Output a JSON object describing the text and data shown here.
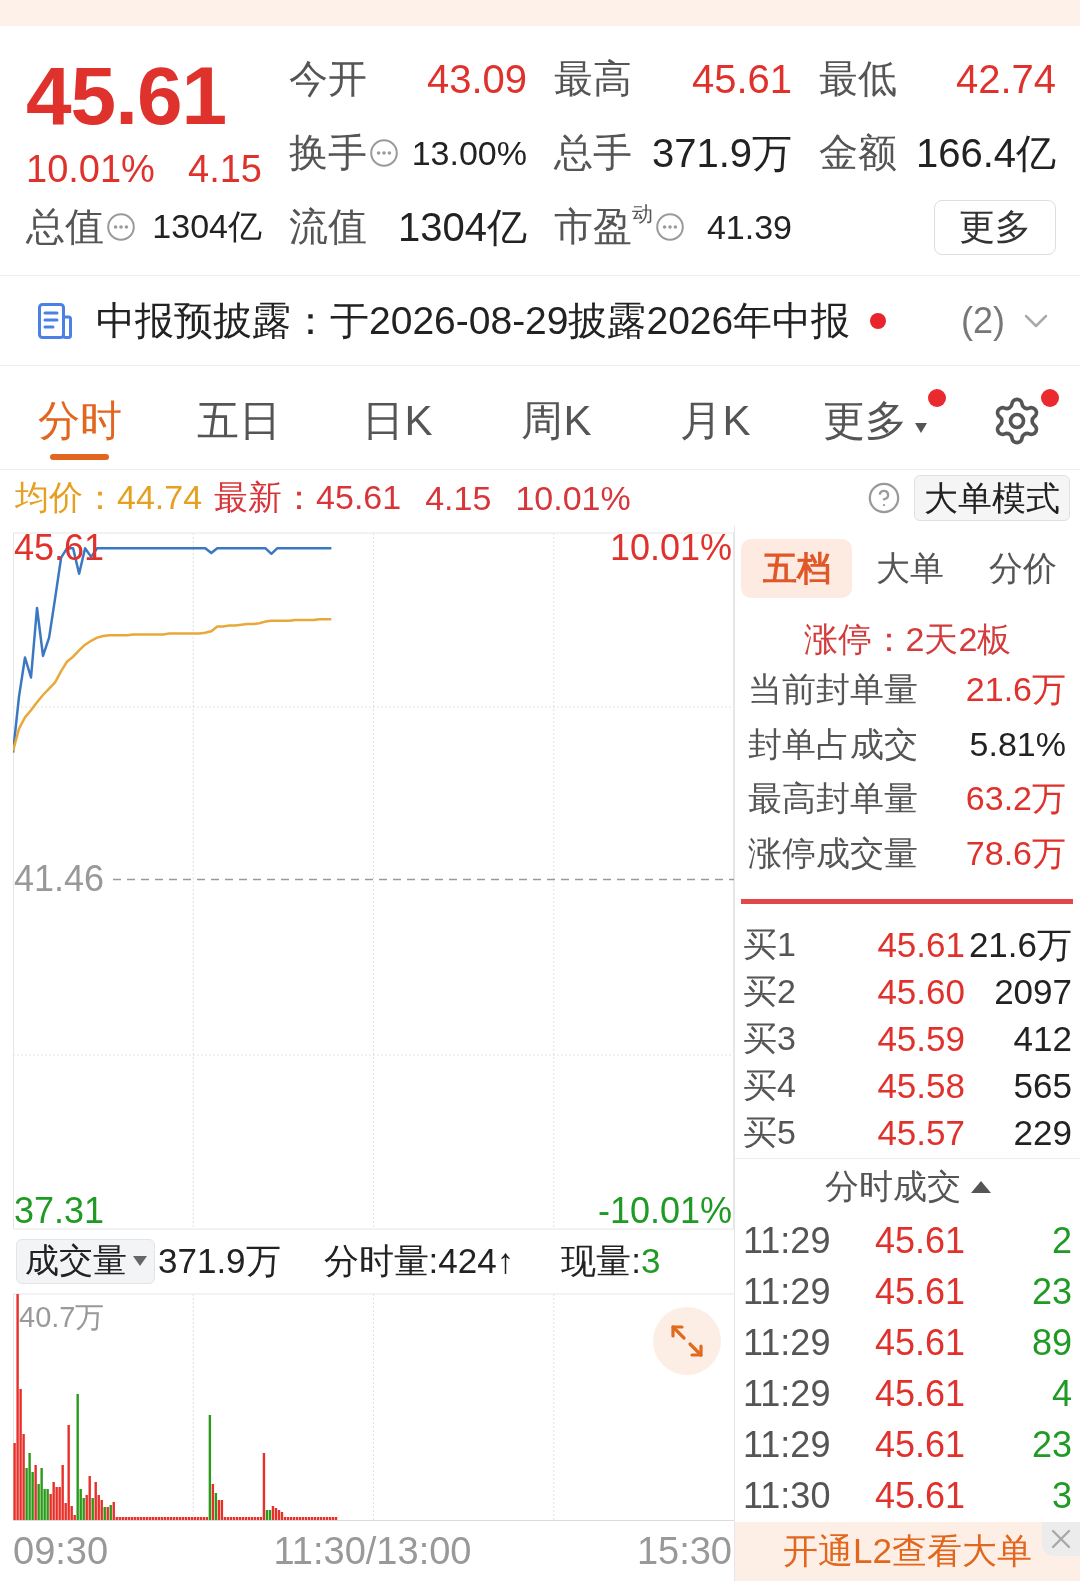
{
  "quote": {
    "price": "45.61",
    "change_pct": "10.01%",
    "change": "4.15",
    "stats": [
      {
        "label": "今开",
        "value": "43.09",
        "color": "#e0322d",
        "info": false
      },
      {
        "label": "最高",
        "value": "45.61",
        "color": "#e0322d",
        "info": false
      },
      {
        "label": "最低",
        "value": "42.74",
        "color": "#e0322d",
        "info": false
      },
      {
        "label": "换手",
        "value": "13.00%",
        "color": "#222222",
        "info": true
      },
      {
        "label": "总手",
        "value": "371.9万",
        "color": "#222222",
        "info": false
      },
      {
        "label": "金额",
        "value": "166.4亿",
        "color": "#222222",
        "info": false
      },
      {
        "label": "总值",
        "value": "1304亿",
        "color": "#222222",
        "info": true
      },
      {
        "label": "流值",
        "value": "1304亿",
        "color": "#222222",
        "info": false
      },
      {
        "label": "市盈$^{动}$",
        "value": "41.39",
        "color": "#222222",
        "info": true
      }
    ],
    "more_button": "更多"
  },
  "notice": {
    "text": "中报预披露：于2026-08-29披露2026年中报",
    "unread": true,
    "count": "(2)"
  },
  "chart_tabs": [
    {
      "label": "分时",
      "selected": true,
      "dropdown": false,
      "badge": false
    },
    {
      "label": "五日",
      "selected": false,
      "dropdown": false,
      "badge": false
    },
    {
      "label": "日K",
      "selected": false,
      "dropdown": false,
      "badge": false
    },
    {
      "label": "周K",
      "selected": false,
      "dropdown": false,
      "badge": false
    },
    {
      "label": "月K",
      "selected": false,
      "dropdown": false,
      "badge": false
    },
    {
      "label": "更多",
      "selected": false,
      "dropdown": true,
      "badge": true
    }
  ],
  "settings": {
    "badge": true
  },
  "info_bar": {
    "average": "均价：44.74",
    "latest": "最新：45.61",
    "change": "4.15",
    "change_pct": "10.01%",
    "mode_button": "大单模式"
  },
  "price_chart": {
    "pct_labels": [
      {
        "text": "10.01%",
        "color": "#e0322d"
      },
      {
        "text": "-10.01%",
        "color": "#1f9a24"
      }
    ],
    "chart_data": {
      "type": "line",
      "categories": [
        null,
        null,
        null,
        null,
        null,
        null,
        null,
        null,
        null,
        null,
        null,
        null,
        null,
        null,
        null,
        null,
        null,
        null,
        null,
        null,
        null,
        null,
        null,
        null,
        null,
        null,
        null,
        null,
        null,
        null,
        null,
        null,
        null,
        null,
        null,
        null,
        null,
        null,
        null,
        null,
        null,
        null,
        null,
        null,
        null,
        null,
        null,
        null,
        null,
        null,
        null,
        null,
        null,
        null,
        null,
        null,
        null,
        null,
        null,
        null,
        null,
        null,
        null,
        null,
        null,
        null,
        null,
        null,
        null,
        null,
        null,
        null,
        null,
        null,
        null,
        null,
        null,
        null,
        null,
        null,
        null,
        null,
        null,
        null,
        null,
        null,
        null,
        null,
        null,
        null,
        null,
        null,
        null,
        null,
        null,
        null,
        null,
        null,
        null,
        null,
        null,
        null,
        null,
        null,
        null,
        null,
        null,
        null,
        null,
        null,
        null,
        null,
        null,
        null,
        null,
        null,
        null,
        null,
        null,
        null,
        null
      ],
      "series": [
        {
          "color": "#3a78c2",
          "values": [
            43.05,
            43.75,
            44.24,
            43.99,
            44.86,
            44.26,
            44.49,
            44.98,
            45.49,
            45.61,
            45.61,
            45.29,
            45.61,
            45.5,
            45.61,
            45.61,
            45.61,
            45.61,
            45.61,
            45.61,
            45.61,
            45.61,
            45.61,
            45.61,
            45.61,
            45.61,
            45.61,
            45.61,
            45.61,
            45.61,
            45.61,
            45.61,
            45.61,
            45.55,
            45.61,
            45.61,
            45.61,
            45.61,
            45.61,
            45.61,
            45.61,
            45.61,
            45.61,
            45.54,
            45.61,
            45.61,
            45.61,
            45.61,
            45.61,
            45.61,
            45.61,
            45.61,
            45.61,
            45.61,
            null,
            null,
            null,
            null,
            null,
            null,
            null,
            null,
            null,
            null,
            null,
            null,
            null,
            null,
            null,
            null,
            null,
            null,
            null,
            null,
            null,
            null,
            null,
            null,
            null,
            null,
            null,
            null,
            null,
            null,
            null,
            null,
            null,
            null,
            null,
            null,
            null,
            null,
            null,
            null,
            null,
            null,
            null,
            null,
            null,
            null,
            null,
            null,
            null,
            null,
            null,
            null,
            null,
            null,
            null,
            null,
            null,
            null,
            null,
            null,
            null,
            null,
            null,
            null,
            null,
            null,
            null
          ]
        },
        {
          "color": "#e8a83a",
          "values": [
            43.07,
            43.35,
            43.49,
            43.58,
            43.68,
            43.77,
            43.85,
            43.93,
            44.07,
            44.19,
            44.25,
            44.33,
            44.4,
            44.45,
            44.49,
            44.51,
            44.52,
            44.52,
            44.52,
            44.52,
            44.53,
            44.53,
            44.53,
            44.53,
            44.53,
            44.53,
            44.54,
            44.54,
            44.54,
            44.54,
            44.54,
            44.54,
            44.55,
            44.57,
            44.63,
            44.63,
            44.64,
            44.64,
            44.65,
            44.66,
            44.66,
            44.67,
            44.69,
            44.7,
            44.7,
            44.7,
            44.7,
            44.71,
            44.71,
            44.71,
            44.71,
            44.72,
            44.72,
            44.72,
            null,
            null,
            null,
            null,
            null,
            null,
            null,
            null,
            null,
            null,
            null,
            null,
            null,
            null,
            null,
            null,
            null,
            null,
            null,
            null,
            null,
            null,
            null,
            null,
            null,
            null,
            null,
            null,
            null,
            null,
            null,
            null,
            null,
            null,
            null,
            null,
            null,
            null,
            null,
            null,
            null,
            null,
            null,
            null,
            null,
            null,
            null,
            null,
            null,
            null,
            null,
            null,
            null,
            null,
            null,
            null,
            null,
            null,
            null,
            null,
            null,
            null,
            null,
            null,
            null,
            null,
            null
          ]
        }
      ],
      "ylim": [
        37.08,
        45.8
      ],
      "yticks": [
        {
          "value": 45.61,
          "label": "45.61"
        },
        {
          "value": 41.46,
          "label": "41.46"
        },
        {
          "value": 37.31,
          "label": "37.31"
        }
      ],
      "ref_lines": [
        {
          "axis": "y",
          "value": 41.46
        }
      ]
    }
  },
  "volume": {
    "selector": "成交量",
    "total": "371.9万",
    "minute_volume": "分时量:424↑",
    "current_label": "现量:",
    "current_value": "3",
    "max_label": "40.7万"
  },
  "time_axis": [
    "09:30",
    "11:30/13:00",
    "15:30"
  ],
  "depth_panel": {
    "tabs": [
      {
        "label": "五档",
        "selected": true
      },
      {
        "label": "大单",
        "selected": false
      },
      {
        "label": "分价",
        "selected": false
      }
    ],
    "limit_up": "涨停：2天2板",
    "seal_stats": [
      {
        "label": "当前封单量",
        "value": "21.6万",
        "color": "#e0322d"
      },
      {
        "label": "封单占成交",
        "value": "5.81%",
        "color": "#222222"
      },
      {
        "label": "最高封单量",
        "value": "63.2万",
        "color": "#e0322d"
      },
      {
        "label": "涨停成交量",
        "value": "78.6万",
        "color": "#e0322d"
      }
    ],
    "bids": [
      {
        "label": "买1",
        "price": "45.61",
        "volume": "21.6万"
      },
      {
        "label": "买2",
        "price": "45.60",
        "volume": "2097"
      },
      {
        "label": "买3",
        "price": "45.59",
        "volume": "412"
      },
      {
        "label": "买4",
        "price": "45.58",
        "volume": "565"
      },
      {
        "label": "买5",
        "price": "45.57",
        "volume": "229"
      }
    ]
  },
  "trades": {
    "title": "分时成交",
    "rows": [
      {
        "time": "11:29",
        "price": "45.61",
        "volume": "2"
      },
      {
        "time": "11:29",
        "price": "45.61",
        "volume": "23"
      },
      {
        "time": "11:29",
        "price": "45.61",
        "volume": "89"
      },
      {
        "time": "11:29",
        "price": "45.61",
        "volume": "4"
      },
      {
        "time": "11:29",
        "price": "45.61",
        "volume": "23"
      },
      {
        "time": "11:30",
        "price": "45.61",
        "volume": "3"
      }
    ]
  },
  "promo_banner": {
    "text": "开通L2查看大单"
  }
}
